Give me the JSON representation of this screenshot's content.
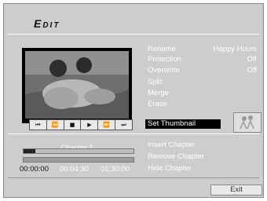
{
  "header": {
    "title": "Edit"
  },
  "controls": [
    {
      "glyph": "⏮",
      "name": "skip-back-button"
    },
    {
      "glyph": "⏪",
      "name": "rewind-button"
    },
    {
      "glyph": "■",
      "name": "stop-button"
    },
    {
      "glyph": "▶",
      "name": "play-button"
    },
    {
      "glyph": "⏩",
      "name": "fast-forward-button"
    },
    {
      "glyph": "⏭",
      "name": "skip-forward-button"
    }
  ],
  "menu": {
    "rename_label": "Rename",
    "rename_value": "Happy Hours",
    "protection_label": "Protection",
    "protection_value": "Off",
    "overwrite_label": "Overwrite",
    "overwrite_value": "Off",
    "split_label": "Split",
    "merge_label": "Merge",
    "erase_label": "Erase",
    "set_thumbnail_label": "Set Thumbnail",
    "insert_chapter_label": "Insert Chapter",
    "remove_chapter_label": "Remove Chapter",
    "hide_chapter_label": "Hide Chapter"
  },
  "chapter": {
    "label": "Chapter 1",
    "current_time": "00:00:00",
    "chapter_time": "00:04:30",
    "total_time": "01:30:00",
    "progress": 0.11
  },
  "footer": {
    "exit_label": "Exit"
  },
  "colors": {
    "panel": "#cdcdcd",
    "text": "#ffffff",
    "highlight": "#000000"
  }
}
